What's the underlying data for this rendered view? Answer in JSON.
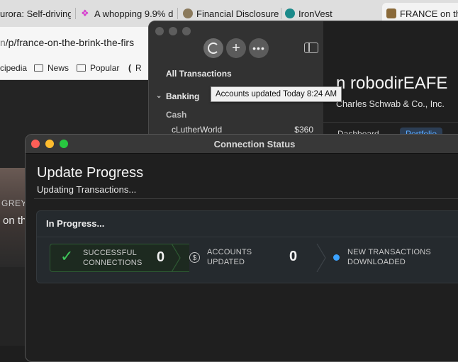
{
  "browser": {
    "tabs": [
      {
        "label": "urora: Self-driving"
      },
      {
        "label": "A whopping 9.9% d"
      },
      {
        "label": "Financial Disclosure"
      },
      {
        "label": "IronVest"
      },
      {
        "label": "FRANCE on th"
      }
    ],
    "url": {
      "dim_prefix": "n",
      "path": "/p/france-on-the-brink-the-firs"
    },
    "bookmarks": [
      "cipedia",
      "News",
      "Popular",
      "R"
    ],
    "page": {
      "grey_text": "GREY",
      "headline_fragment": "on th"
    }
  },
  "accounts_app": {
    "sidebar": {
      "all_transactions": "All Transactions",
      "banking": "Banking",
      "cash": "Cash",
      "account": {
        "name": "cLutherWorld",
        "amount": "$360"
      }
    },
    "main": {
      "title": "n robodirEAFE",
      "institution": "Charles Schwab & Co., Inc.",
      "tab_dashboard": "Dashboard",
      "tab_portfolio": "Portfolio"
    },
    "tooltip": "Accounts updated Today 8:24 AM"
  },
  "connection_status": {
    "window_title": "Connection Status",
    "heading": "Update Progress",
    "subheading": "Updating Transactions...",
    "panel_title": "In Progress...",
    "stages": [
      {
        "label_line1": "SUCCESSFUL",
        "label_line2": "CONNECTIONS",
        "count": "0",
        "icon": "checkmark-icon"
      },
      {
        "label_line1": "ACCOUNTS",
        "label_line2": "UPDATED",
        "count": "0",
        "icon": "dollar-circle-icon"
      },
      {
        "label_line1": "NEW TRANSACTIONS",
        "label_line2": "DOWNLOADED",
        "count": "",
        "icon": "blue-dot-icon"
      }
    ]
  },
  "colors": {
    "accent_green": "#3ec65a",
    "accent_blue": "#3ba2ff"
  }
}
